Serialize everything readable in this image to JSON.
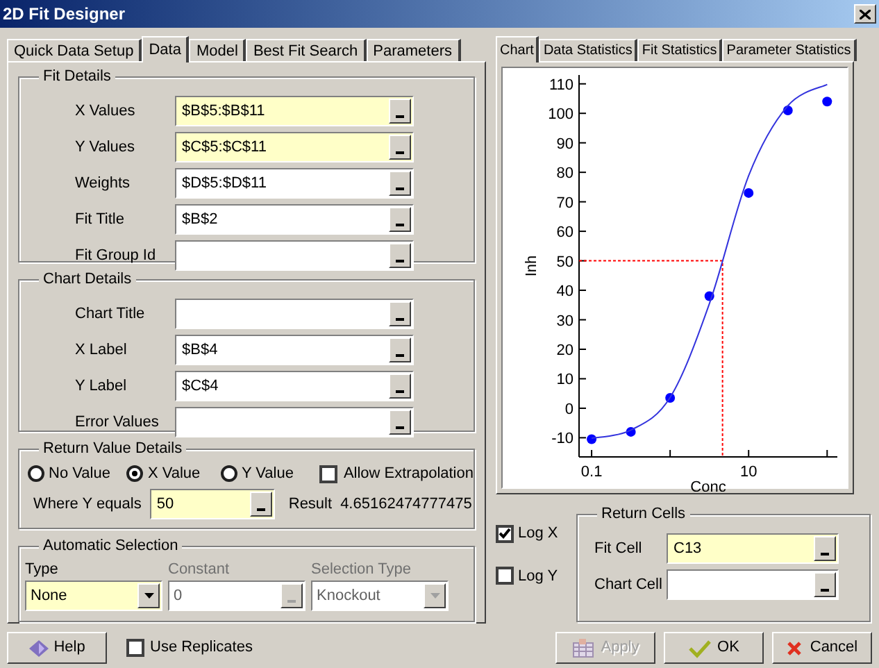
{
  "window": {
    "title": "2D Fit Designer"
  },
  "left_tabs": [
    {
      "label": "Quick Data Setup",
      "selected": false
    },
    {
      "label": "Data",
      "selected": true
    },
    {
      "label": "Model",
      "selected": false
    },
    {
      "label": "Best Fit Search",
      "selected": false
    },
    {
      "label": "Parameters",
      "selected": false
    }
  ],
  "fit_details": {
    "title": "Fit Details",
    "fields": [
      {
        "label": "X Values",
        "value": "$B$5:$B$11",
        "highlighted": true
      },
      {
        "label": "Y Values",
        "value": "$C$5:$C$11",
        "highlighted": true
      },
      {
        "label": "Weights",
        "value": "$D$5:$D$11",
        "highlighted": false
      },
      {
        "label": "Fit Title",
        "value": "$B$2",
        "highlighted": false
      },
      {
        "label": "Fit Group Id",
        "highlighted": false
      }
    ]
  },
  "chart_details": {
    "title": "Chart Details",
    "fields": [
      {
        "label": "Chart Title",
        "highlighted": false
      },
      {
        "label": "X Label",
        "value": "$B$4",
        "highlighted": false
      },
      {
        "label": "Y Label",
        "value": "$C$4",
        "highlighted": false
      },
      {
        "label": "Error Values",
        "highlighted": false
      }
    ]
  },
  "return_value": {
    "title": "Return Value Details",
    "options": [
      {
        "label": "No Value",
        "selected": false
      },
      {
        "label": "X Value",
        "selected": true
      },
      {
        "label": "Y Value",
        "selected": false
      }
    ],
    "allow_extrapolation": {
      "label": "Allow Extrapolation",
      "checked": false
    },
    "where_label": "Where Y equals",
    "where_value": "50",
    "result_label": "Result",
    "result_value": "4.65162474777475"
  },
  "automatic_selection": {
    "title": "Automatic Selection",
    "controls": [
      {
        "kind": "dropdown",
        "label": "Type",
        "value": "None",
        "disabled": false,
        "highlighted": true
      },
      {
        "kind": "field",
        "label": "Constant",
        "value": "0",
        "disabled": true,
        "highlighted": false
      },
      {
        "kind": "dropdown",
        "label": "Selection Type",
        "value": "Knockout",
        "disabled": true,
        "highlighted": false
      }
    ]
  },
  "right_tabs": [
    {
      "label": "Chart",
      "selected": true
    },
    {
      "label": "Data Statistics",
      "selected": false
    },
    {
      "label": "Fit Statistics",
      "selected": false
    },
    {
      "label": "Parameter Statistics",
      "selected": false
    }
  ],
  "chart_data": {
    "type": "scatter",
    "xlabel": "Conc",
    "ylabel": "Inh",
    "categories": [
      "0.1",
      null,
      null,
      null,
      "10",
      null,
      null
    ],
    "series": [
      {
        "color": "#0000ff",
        "values": [
          -10.5,
          -8,
          3.5,
          38,
          73,
          101,
          104
        ]
      },
      {
        "type": "line",
        "color": "#3333dd",
        "values": [
          -10.2,
          -7.4,
          3.7,
          35.4,
          78.8,
          102.6,
          109.8
        ]
      }
    ],
    "ylim": [
      -16.5,
      113
    ],
    "ref_lines": [
      {
        "axis": "y",
        "value": 50,
        "color": "#ff0000"
      }
    ],
    "yticks": [
      -10,
      0,
      10,
      20,
      30,
      40,
      50,
      60,
      70,
      80,
      90,
      100,
      110
    ]
  },
  "log_x": {
    "label": "Log X",
    "checked": true
  },
  "log_y": {
    "label": "Log Y",
    "checked": false
  },
  "return_cells": {
    "title": "Return Cells",
    "fields": [
      {
        "label": "Fit Cell",
        "value": "C13",
        "highlighted": true
      },
      {
        "label": "Chart Cell",
        "highlighted": false
      }
    ]
  },
  "help_button": {
    "label": "Help"
  },
  "use_replicates": {
    "label": "Use Replicates",
    "checked": false
  },
  "buttons": [
    {
      "kind": "apply",
      "label": "Apply",
      "disabled": true
    },
    {
      "kind": "ok",
      "label": "OK",
      "disabled": false
    },
    {
      "kind": "cancel",
      "label": "Cancel",
      "disabled": false
    }
  ]
}
